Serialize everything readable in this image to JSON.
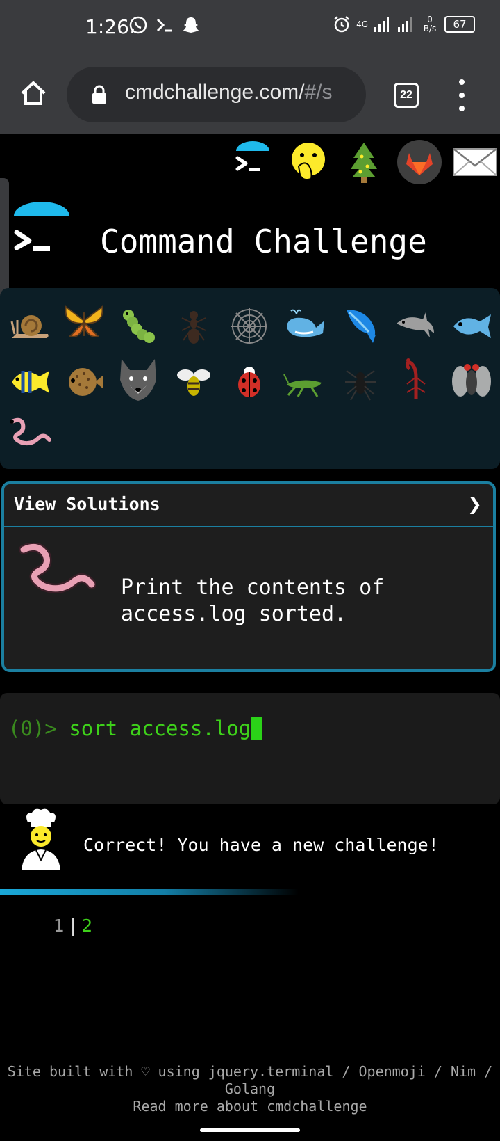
{
  "status_bar": {
    "time": "1:26",
    "network": "4G",
    "data_rate": "0 B/s",
    "battery": "67"
  },
  "browser": {
    "url_main": "cmdchallenge.com/",
    "url_rest": "#/s",
    "tab_count": "22"
  },
  "site": {
    "title": "Command Challenge",
    "nav_icons": [
      "terminal-icon",
      "face-with-hand-over-mouth-icon",
      "tree-icon",
      "gitlab-icon",
      "envelope-icon"
    ],
    "animal_icons": [
      "snail",
      "butterfly",
      "caterpillar",
      "ant",
      "spider-web",
      "whale",
      "whale-2",
      "dolphin",
      "fish",
      "tropical-fish",
      "blowfish",
      "wolf",
      "honeybee",
      "lady-beetle",
      "cricket",
      "spider",
      "scorpion",
      "fly",
      "worm"
    ]
  },
  "challenge": {
    "header": "View Solutions",
    "chevron": "❯",
    "description_line1": "Print the contents of",
    "description_line2": "access.log sorted."
  },
  "terminal": {
    "prompt_prefix": "(0)> ",
    "command": "sort access.log"
  },
  "result": {
    "message": "Correct! You have a new challenge!"
  },
  "pager": {
    "page1": "1",
    "separator": "|",
    "page2": "2"
  },
  "footer": {
    "line1": "Site built with ♡ using jquery.terminal / Openmoji / Nim / Golang",
    "line2": "Read more about cmdchallenge"
  },
  "colors": {
    "accent": "#1b7fa0",
    "terminal_green": "#3ed11a",
    "animal_panel": "#0c1e26"
  }
}
